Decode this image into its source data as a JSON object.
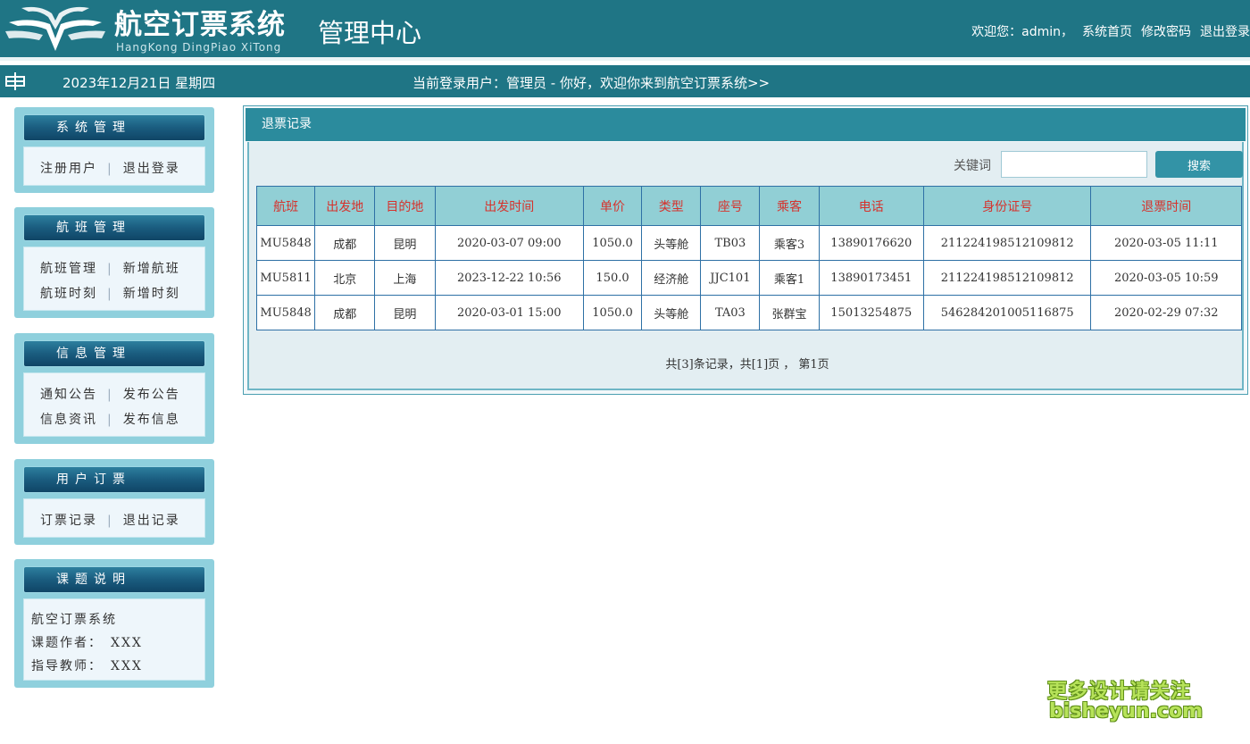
{
  "colors": {
    "header_bg": "#1f7585",
    "table_header_bg": "#91cfd5",
    "table_header_text": "#d6322c",
    "search_button": "#3393a6"
  },
  "header": {
    "logo_title": "航空订票系统",
    "logo_subtitle": "HangKong DingPiao XiTong",
    "center_title": "管理中心",
    "links": {
      "welcome": "欢迎您：admin，",
      "home": "系统首页",
      "change_password": "修改密码",
      "logout": "退出登录"
    }
  },
  "infobar": {
    "icon": "grid-icon",
    "date": "2023年12月21日 星期四",
    "welcome": "当前登录用户：管理员 - 你好，欢迎你来到航空订票系统>>"
  },
  "sidebar": {
    "system": {
      "title": "系统管理",
      "items": [
        "注册用户",
        "退出登录"
      ]
    },
    "flight": {
      "title": "航班管理",
      "items": [
        "航班管理",
        "新增航班",
        "航班时刻",
        "新增时刻"
      ]
    },
    "info": {
      "title": "信息管理",
      "items": [
        "通知公告",
        "发布公告",
        "信息资讯",
        "发布信息"
      ]
    },
    "order": {
      "title": "用户订票",
      "items": [
        "订票记录",
        "退出记录"
      ]
    },
    "about": {
      "title": "课题说明",
      "lines": [
        "航空订票系统",
        "课题作者：　XXX",
        "指导教师：　XXX"
      ]
    }
  },
  "main": {
    "title": "退票记录",
    "search": {
      "label": "关键词",
      "value": "",
      "button": "搜索"
    },
    "table": {
      "headers": [
        "航班",
        "出发地",
        "目的地",
        "出发时间",
        "单价",
        "类型",
        "座号",
        "乘客",
        "电话",
        "身份证号",
        "退票时间"
      ],
      "rows": [
        [
          "MU5848",
          "成都",
          "昆明",
          "2020-03-07 09:00",
          "1050.0",
          "头等舱",
          "TB03",
          "乘客3",
          "13890176620",
          "211224198512109812",
          "2020-03-05 11:11"
        ],
        [
          "MU5811",
          "北京",
          "上海",
          "2023-12-22 10:56",
          "150.0",
          "经济舱",
          "JJC101",
          "乘客1",
          "13890173451",
          "211224198512109812",
          "2020-03-05 10:59"
        ],
        [
          "MU5848",
          "成都",
          "昆明",
          "2020-03-01 15:00",
          "1050.0",
          "头等舱",
          "TA03",
          "张群宝",
          "15013254875",
          "546284201005116875",
          "2020-02-29 07:32"
        ]
      ]
    },
    "pager": "共[3]条记录，共[1]页 ， 第1页"
  },
  "watermark": {
    "line1": "更多设计请关注",
    "line2": "bisheyun.com"
  }
}
